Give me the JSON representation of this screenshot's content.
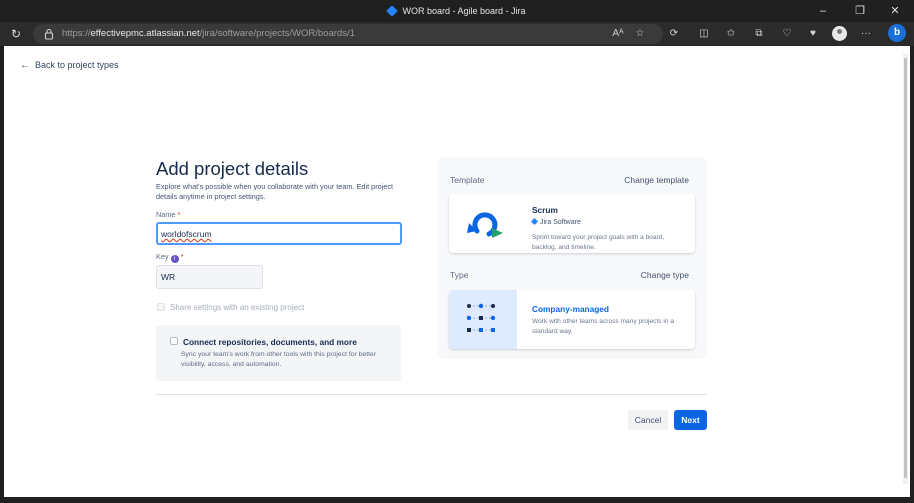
{
  "window": {
    "title": "WOR board - Agile board - Jira"
  },
  "browser": {
    "url_prefix": "https://",
    "url_host": "effectivepmc.atlassian.net",
    "url_path": "/jira/software/projects/WOR/boards/1"
  },
  "page": {
    "back_label": "Back to project types",
    "title": "Add project details",
    "description": "Explore what's possible when you collaborate with your team. Edit project details anytime in project settings.",
    "name_label": "Name",
    "name_value": "worldofscrum",
    "key_label": "Key",
    "key_value": "WR",
    "required_mark": "*",
    "share_label": "Share settings with an existing project",
    "connect": {
      "title": "Connect repositories, documents, and more",
      "subtitle": "Sync your team's work from other tools with this project for better visibility, access, and automation."
    },
    "template": {
      "section_label": "Template",
      "change_label": "Change template",
      "name": "Scrum",
      "product": "Jira Software",
      "description": "Sprint toward your project goals with a board, backlog, and timeline."
    },
    "type": {
      "section_label": "Type",
      "change_label": "Change type",
      "name": "Company-managed",
      "description": "Work with other teams across many projects in a standard way."
    },
    "cancel_label": "Cancel",
    "next_label": "Next"
  },
  "colors": {
    "primary": "#0c66e4",
    "focus": "#4c9aff",
    "jira": "#2684ff"
  }
}
